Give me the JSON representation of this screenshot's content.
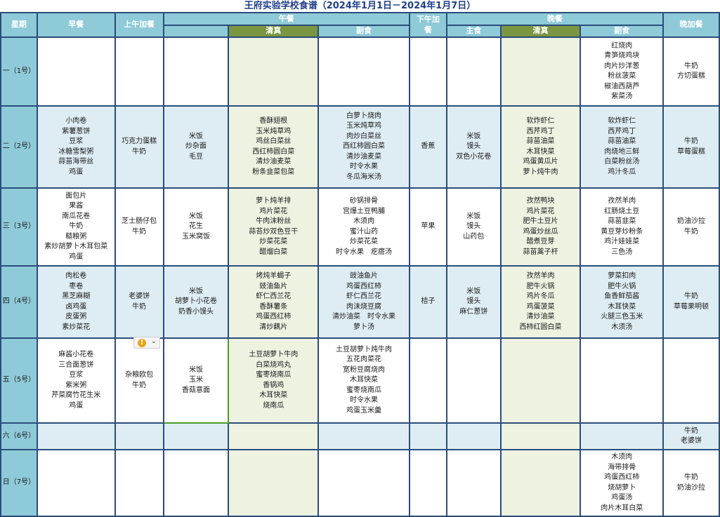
{
  "title": "王府实验学校食谱（2024年1月1日－2024年1月7日）",
  "headers": {
    "weekday": "星期",
    "breakfast": "早餐",
    "morning_snack": "上午加餐",
    "lunch": "午餐",
    "lunch_halal": "清真",
    "lunch_side": "副食",
    "afternoon_snack": "下午加餐",
    "dinner": "晚餐",
    "dinner_staple": "主食",
    "dinner_halal": "清真",
    "dinner_side": "副食",
    "night_snack": "晚加餐"
  },
  "days": [
    {
      "label": "一（1号）",
      "breakfast": "",
      "morning_snack": "",
      "lunch_staple": "",
      "lunch_halal": "",
      "lunch_side": "",
      "afternoon_snack": "",
      "dinner_staple": "",
      "dinner_halal": "",
      "dinner_side": "红烧肉\n青笋烧鸡块\n肉片炒洋葱\n粉丝菠菜\n椒油西葫芦\n紫菜汤",
      "night_snack": "牛奶\n方切蛋糕"
    },
    {
      "label": "二（2号）",
      "breakfast": "小肉卷\n紫薯葱饼\n豆浆\n冰糖雪梨粥\n蒜苗海带丝\n鸡蛋",
      "morning_snack": "巧克力蛋糕\n牛奶",
      "lunch_staple": "米饭\n炒杂面\n毛豆",
      "lunch_halal": "香酥翅根\n玉米炖草鸡\n鸡丝白菜丝\n西红柿圆白菜\n清炒油麦菜\n粉条韭菜包菜",
      "lunch_side": "白萝卜烧肉\n玉米炖草鸡\n肉炒白菜丝\n西红柿圆白菜\n清炒油麦菜\n时令水果\n冬瓜海米汤",
      "afternoon_snack": "香蕉",
      "dinner_staple": "米饭\n馒头\n双色小花卷",
      "dinner_halal": "软炸虾仁\n西芹鸡丁\n蒜苗油菜\n木耳快菜\n鸡蛋黄瓜片\n萝卜炖牛肉",
      "dinner_side": "软炸虾仁\n西芹鸡丁\n蒜苗油菜\n肉烧地三鲜\n白菜粉丝汤\n鸡汁冬瓜",
      "night_snack": "牛奶\n草莓蛋糕"
    },
    {
      "label": "三（3号）",
      "breakfast": "面包片\n果酱\n南瓜花卷\n牛奶\n糙粮粥\n素炒胡萝卜木耳包菜\n鸡蛋",
      "morning_snack": "芝士肠仔包\n牛奶",
      "lunch_staple": "米饭\n花生\n玉米窝饭",
      "lunch_halal": "萝卜炖羊排\n鸡片菜花\n牛肉沫粉丝\n蒜苔炒双色豆干\n炒菜花菜\n醋熘白菜",
      "lunch_side": "砂锅排骨\n宫爆土豆鸭脯\n木须肉\n蜜汁山药\n炒菜花菜\n时令水果　疙瘩汤",
      "afternoon_snack": "苹果",
      "dinner_staple": "米饭\n馒头\n山药包",
      "dinner_halal": "孜然鸭块\n鸡片菜花\n肥牛土豆片\n鸡蛋炒丝瓜\n醋煮豆芽\n蒜苗蒿子杆",
      "dinner_side": "孜然羊肉\n红肠烧土豆\n蒜苗韭菜\n黄豆芽炒粉条\n鸡汁娃娃菜\n三色汤",
      "night_snack": "奶油沙拉\n牛奶"
    },
    {
      "label": "四（4号）",
      "breakfast": "肉松卷\n枣卷\n黑芝麻糊\n卤鸡蛋\n皮蛋粥\n素炒菜花",
      "morning_snack": "老婆饼\n牛奶",
      "lunch_staple": "米饭\n胡萝卜小花卷\n奶香小馒头",
      "lunch_halal": "烤炖羊蝎子\n豉油鱼片\n虾仁西兰花\n香酥薯条\n鸡蛋西红柿\n清炒藕片",
      "lunch_side": "豉油鱼片\n鸡蛋西红柿\n虾仁西兰花\n肉沫烧豆腐\n清炒油菜　时令水果\n萝卜汤",
      "afternoon_snack": "桔子",
      "dinner_staple": "米饭\n馒头\n麻仁葱饼",
      "dinner_halal": "孜然羊肉\n肥牛火锅\n鸡片冬瓜\n鸡蛋菠菜\n清炒油菜\n西柿红圆白菜",
      "dinner_side": "萝菜扣肉\n肥牛火锅\n鱼香鲜茄酱\n木耳快菜\n火腿三色玉米\n木须汤",
      "night_snack": "牛奶\n草莓果明顿"
    },
    {
      "label": "五（5号）",
      "breakfast": "麻酱小花卷\n三合面葱饼\n豆浆\n紫米粥\n芹菜腐竹花生米\n鸡蛋",
      "morning_snack": "杂粮欧包\n牛奶",
      "lunch_staple": "米饭\n玉米\n香菇意面",
      "lunch_halal": "土豆胡萝卜牛肉\n白菜烧鸡丸\n蜜枣烧南瓜\n香锅鸡\n木耳快菜\n烧南瓜",
      "lunch_side": "土豆胡萝卜炖牛肉\n五花肉菜花\n宽粉豆腐烧肉\n木耳快菜\n蜜枣烧南瓜\n时令水果\n鸡蛋玉米羹",
      "afternoon_snack": "",
      "dinner_staple": "",
      "dinner_halal": "",
      "dinner_side": "",
      "night_snack": ""
    },
    {
      "label": "六（6号）",
      "breakfast": "",
      "morning_snack": "",
      "lunch_staple": "",
      "lunch_halal": "",
      "lunch_side": "",
      "afternoon_snack": "",
      "dinner_staple": "",
      "dinner_halal": "",
      "dinner_side": "",
      "night_snack": "牛奶\n老婆饼"
    },
    {
      "label": "日（7号）",
      "breakfast": "",
      "morning_snack": "",
      "lunch_staple": "",
      "lunch_halal": "",
      "lunch_side": "",
      "afternoon_snack": "",
      "dinner_staple": "",
      "dinner_halal": "",
      "dinner_side": "木须肉\n海带排骨\n鸡蛋西红柿\n烧胡萝卜\n鸡蛋汤\n肉片木耳白菜",
      "night_snack": "牛奶\n奶油沙拉"
    }
  ],
  "colors": {
    "header_bg": "#8ecad8",
    "subheader_bg": "#7a9640",
    "halal_bg": "#edf2e1",
    "alt_row_bg": "#deedf3",
    "grid_line": "#2a4d7a",
    "title_color": "#1f3f8a",
    "warning_icon": "#e8a317"
  },
  "icons": {
    "warning": "warning-icon",
    "dropdown": "chevron-down-icon"
  }
}
